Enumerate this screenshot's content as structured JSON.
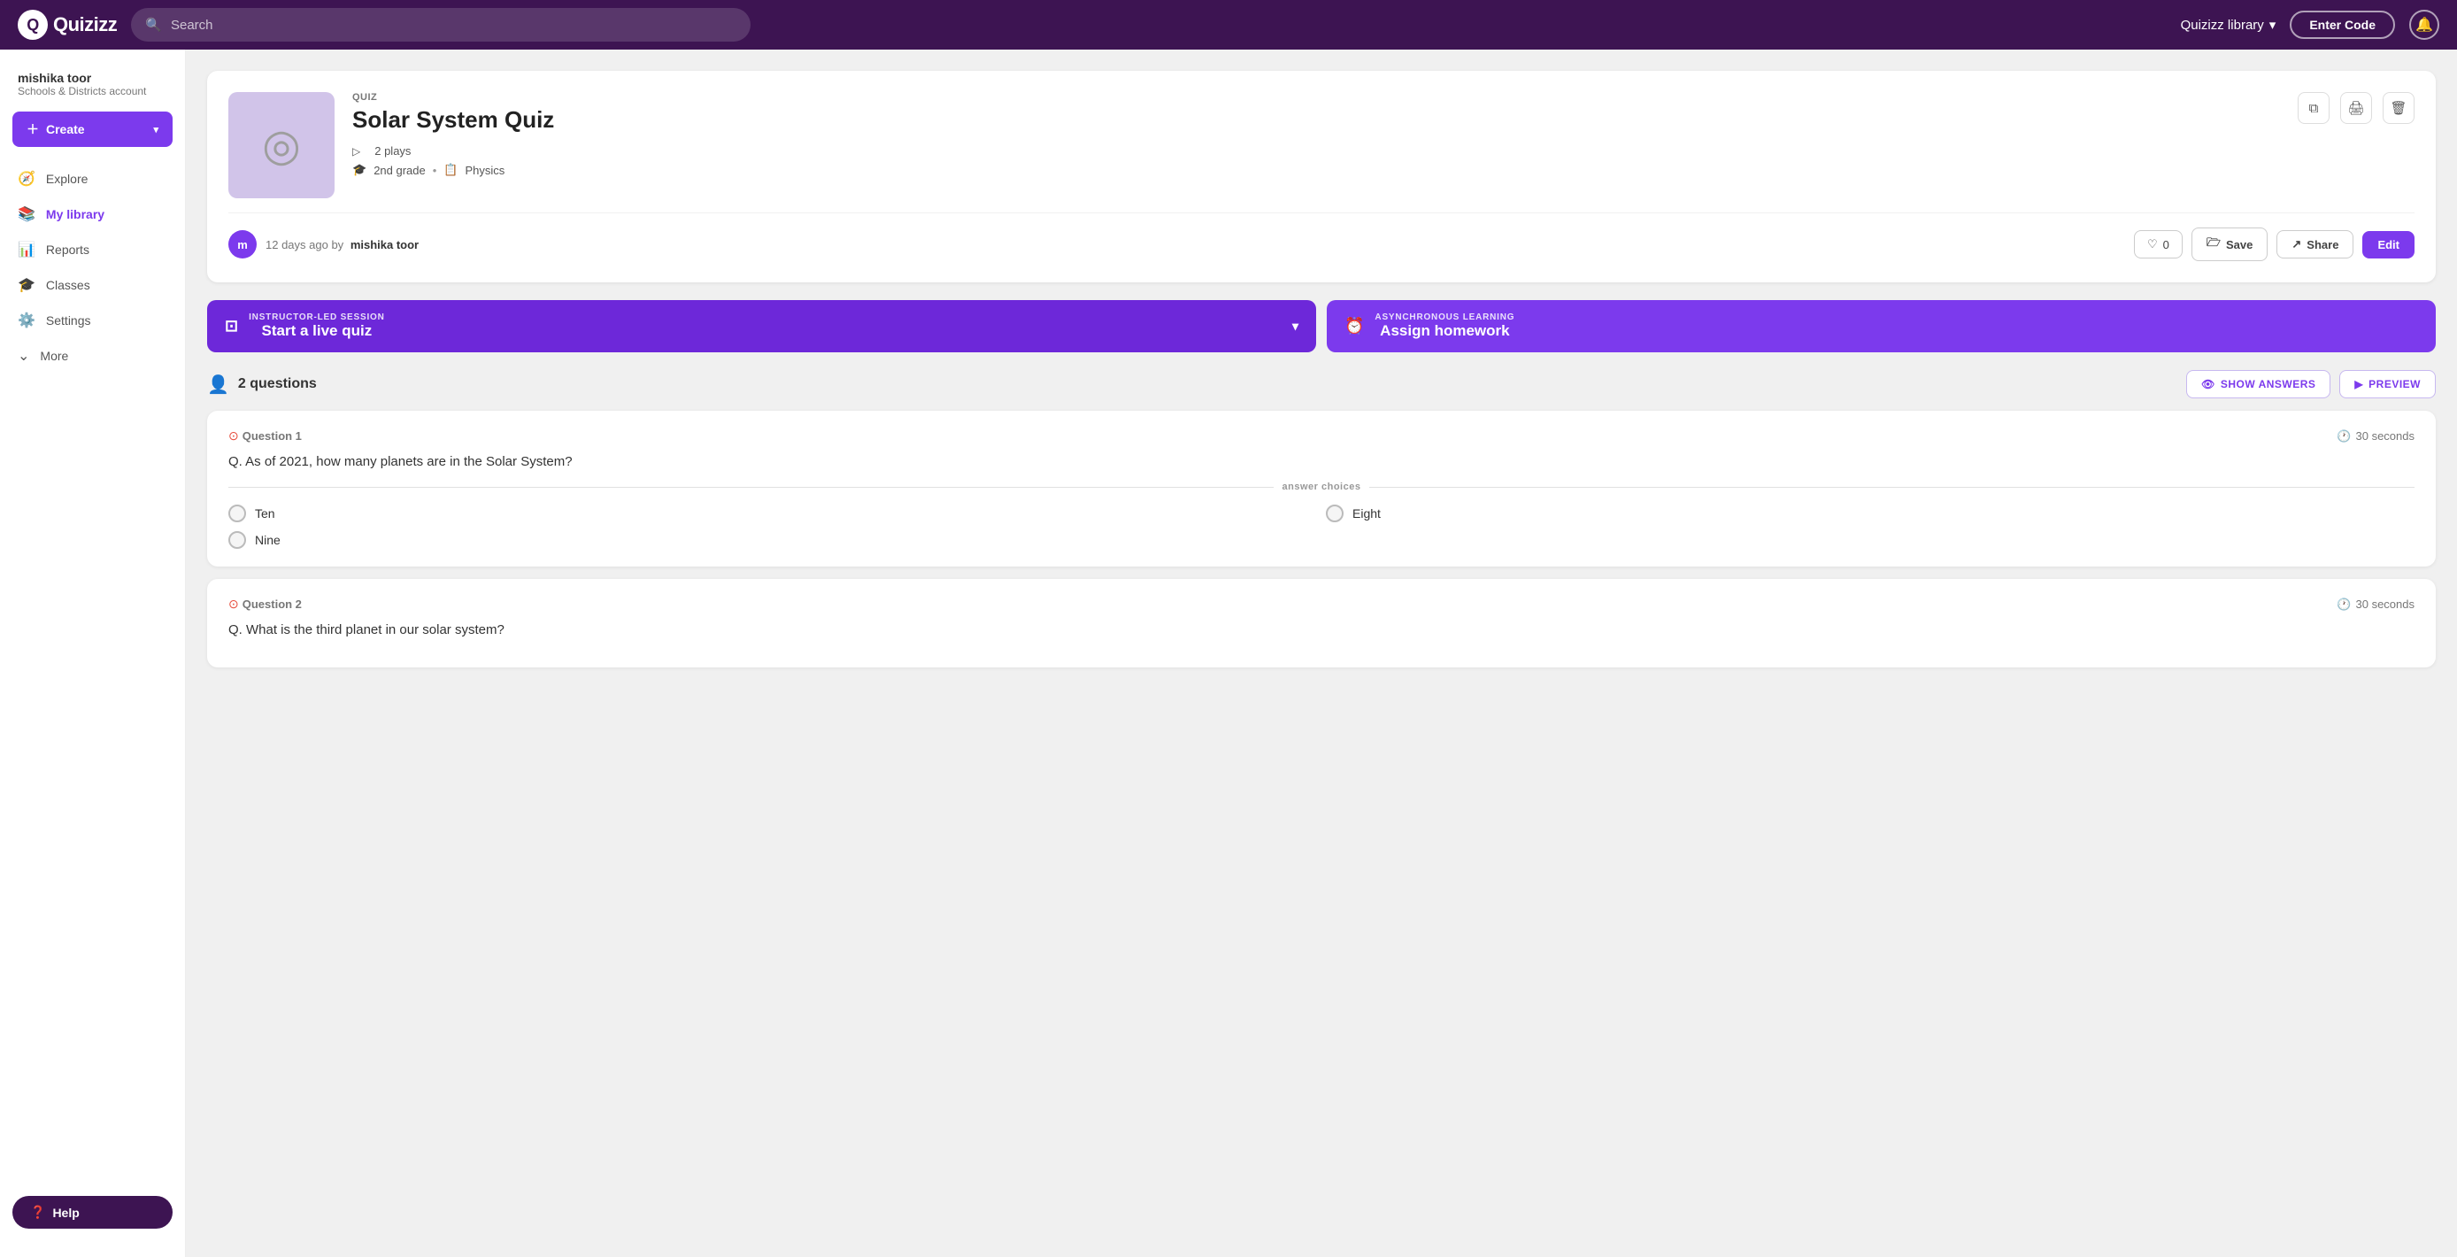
{
  "header": {
    "logo_text": "Quizizz",
    "search_placeholder": "Search",
    "library_label": "Quizizz library",
    "enter_code_label": "Enter Code"
  },
  "sidebar": {
    "user_name": "mishika toor",
    "user_sub": "Schools & Districts account",
    "create_label": "Create",
    "nav_items": [
      {
        "id": "explore",
        "label": "Explore",
        "icon": "🧭"
      },
      {
        "id": "my-library",
        "label": "My library",
        "icon": "📚",
        "active": true
      },
      {
        "id": "reports",
        "label": "Reports",
        "icon": "📊"
      },
      {
        "id": "classes",
        "label": "Classes",
        "icon": "🎓"
      },
      {
        "id": "settings",
        "label": "Settings",
        "icon": "⚙️"
      },
      {
        "id": "more",
        "label": "More",
        "icon": "⌄"
      }
    ],
    "help_label": "Help"
  },
  "quiz": {
    "type_label": "QUIZ",
    "title": "Solar System Quiz",
    "plays": "2 plays",
    "grade": "2nd grade",
    "subject": "Physics",
    "author_time": "12 days ago by",
    "author_name": "mishika toor",
    "likes": "0",
    "save_label": "Save",
    "share_label": "Share",
    "edit_label": "Edit"
  },
  "sessions": {
    "live": {
      "type_label": "INSTRUCTOR-LED SESSION",
      "title": "Start a live quiz"
    },
    "async": {
      "type_label": "ASYNCHRONOUS LEARNING",
      "title": "Assign homework"
    }
  },
  "questions_section": {
    "count_label": "2 questions",
    "show_answers_label": "SHOW ANSWERS",
    "preview_label": "PREVIEW",
    "questions": [
      {
        "label": "Question 1",
        "timer": "30 seconds",
        "text": "Q. As of 2021, how many planets are in the Solar System?",
        "answers_divider": "answer choices",
        "choices": [
          {
            "text": "Ten",
            "col": 1
          },
          {
            "text": "Eight",
            "col": 2
          },
          {
            "text": "Nine",
            "col": 1
          }
        ]
      },
      {
        "label": "Question 2",
        "timer": "30 seconds",
        "text": "Q. What is the third planet in our solar system?"
      }
    ]
  }
}
